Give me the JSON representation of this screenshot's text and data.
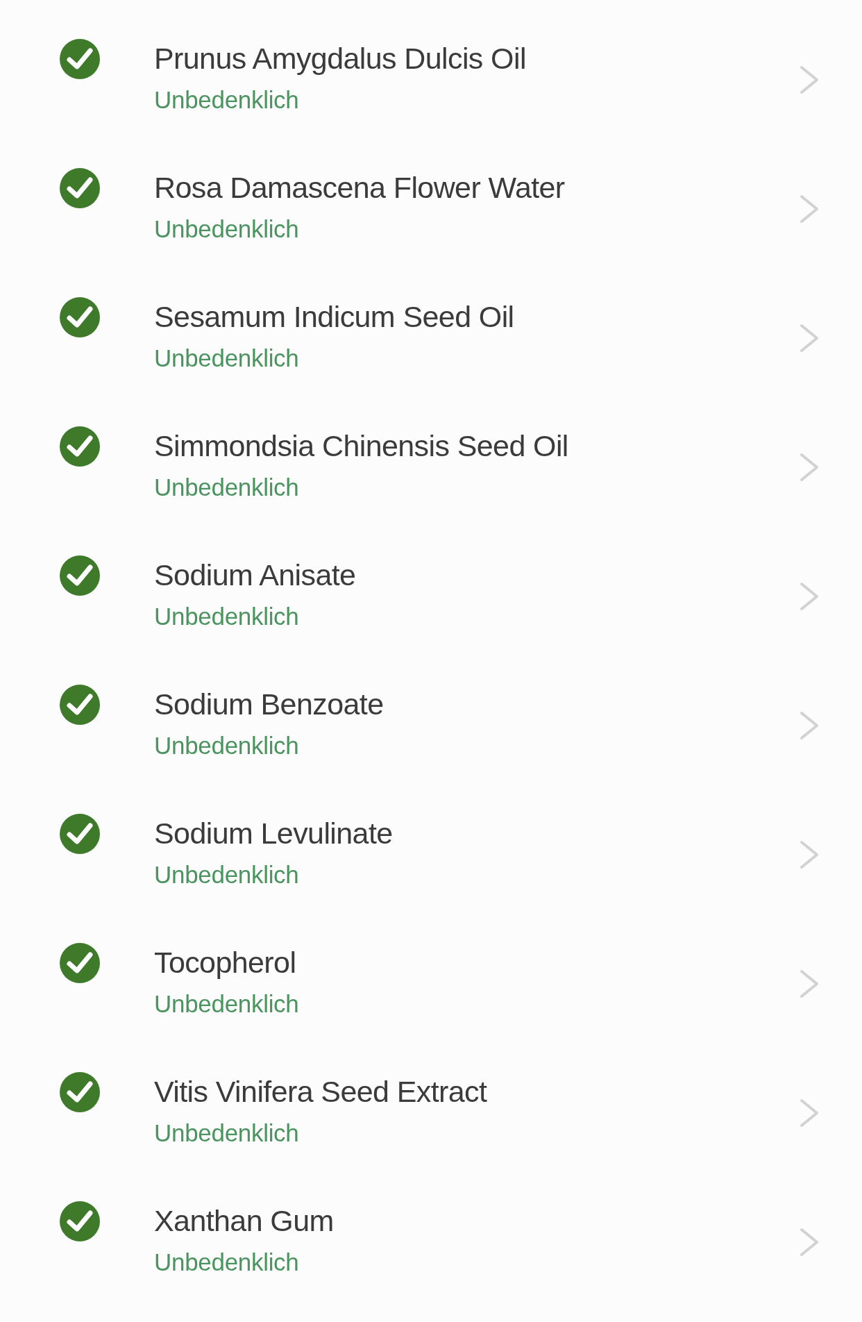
{
  "ingredients": [
    {
      "name": "Prunus Amygdalus Dulcis Oil",
      "rating": "Unbedenklich",
      "kind": "safe"
    },
    {
      "name": "Rosa Damascena Flower Water",
      "rating": "Unbedenklich",
      "kind": "safe"
    },
    {
      "name": "Sesamum Indicum Seed Oil",
      "rating": "Unbedenklich",
      "kind": "safe"
    },
    {
      "name": "Simmondsia Chinensis Seed Oil",
      "rating": "Unbedenklich",
      "kind": "safe"
    },
    {
      "name": "Sodium Anisate",
      "rating": "Unbedenklich",
      "kind": "safe"
    },
    {
      "name": "Sodium Benzoate",
      "rating": "Unbedenklich",
      "kind": "safe"
    },
    {
      "name": "Sodium Levulinate",
      "rating": "Unbedenklich",
      "kind": "safe"
    },
    {
      "name": "Tocopherol",
      "rating": "Unbedenklich",
      "kind": "safe"
    },
    {
      "name": "Vitis Vinifera Seed Extract",
      "rating": "Unbedenklich",
      "kind": "safe"
    },
    {
      "name": "Xanthan Gum",
      "rating": "Unbedenklich",
      "kind": "safe"
    }
  ]
}
